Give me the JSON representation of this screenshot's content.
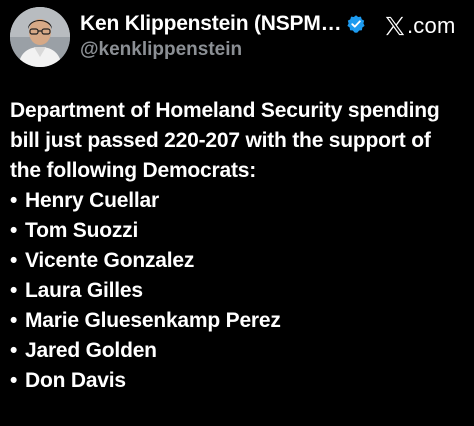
{
  "author": {
    "display_name": "Ken Klippenstein (NSPM…",
    "handle": "@kenklippenstein",
    "verified": true
  },
  "brand": {
    "icon": "x-logo-icon",
    "text": ".com"
  },
  "tweet": {
    "lines": [
      "Department of Homeland Security spending",
      "bill just passed 220-207 with the support of",
      "the following Democrats:"
    ],
    "bullet": "•",
    "democrats": [
      "Henry Cuellar",
      "Tom Suozzi",
      "Vicente Gonzalez",
      "Laura Gilles",
      "Marie Gluesenkamp Perez",
      "Jared Golden",
      "Don Davis"
    ]
  },
  "colors": {
    "background": "#000000",
    "text": "#ffffff",
    "handle": "#8b8f94",
    "verified_badge": "#1d9bf0"
  }
}
